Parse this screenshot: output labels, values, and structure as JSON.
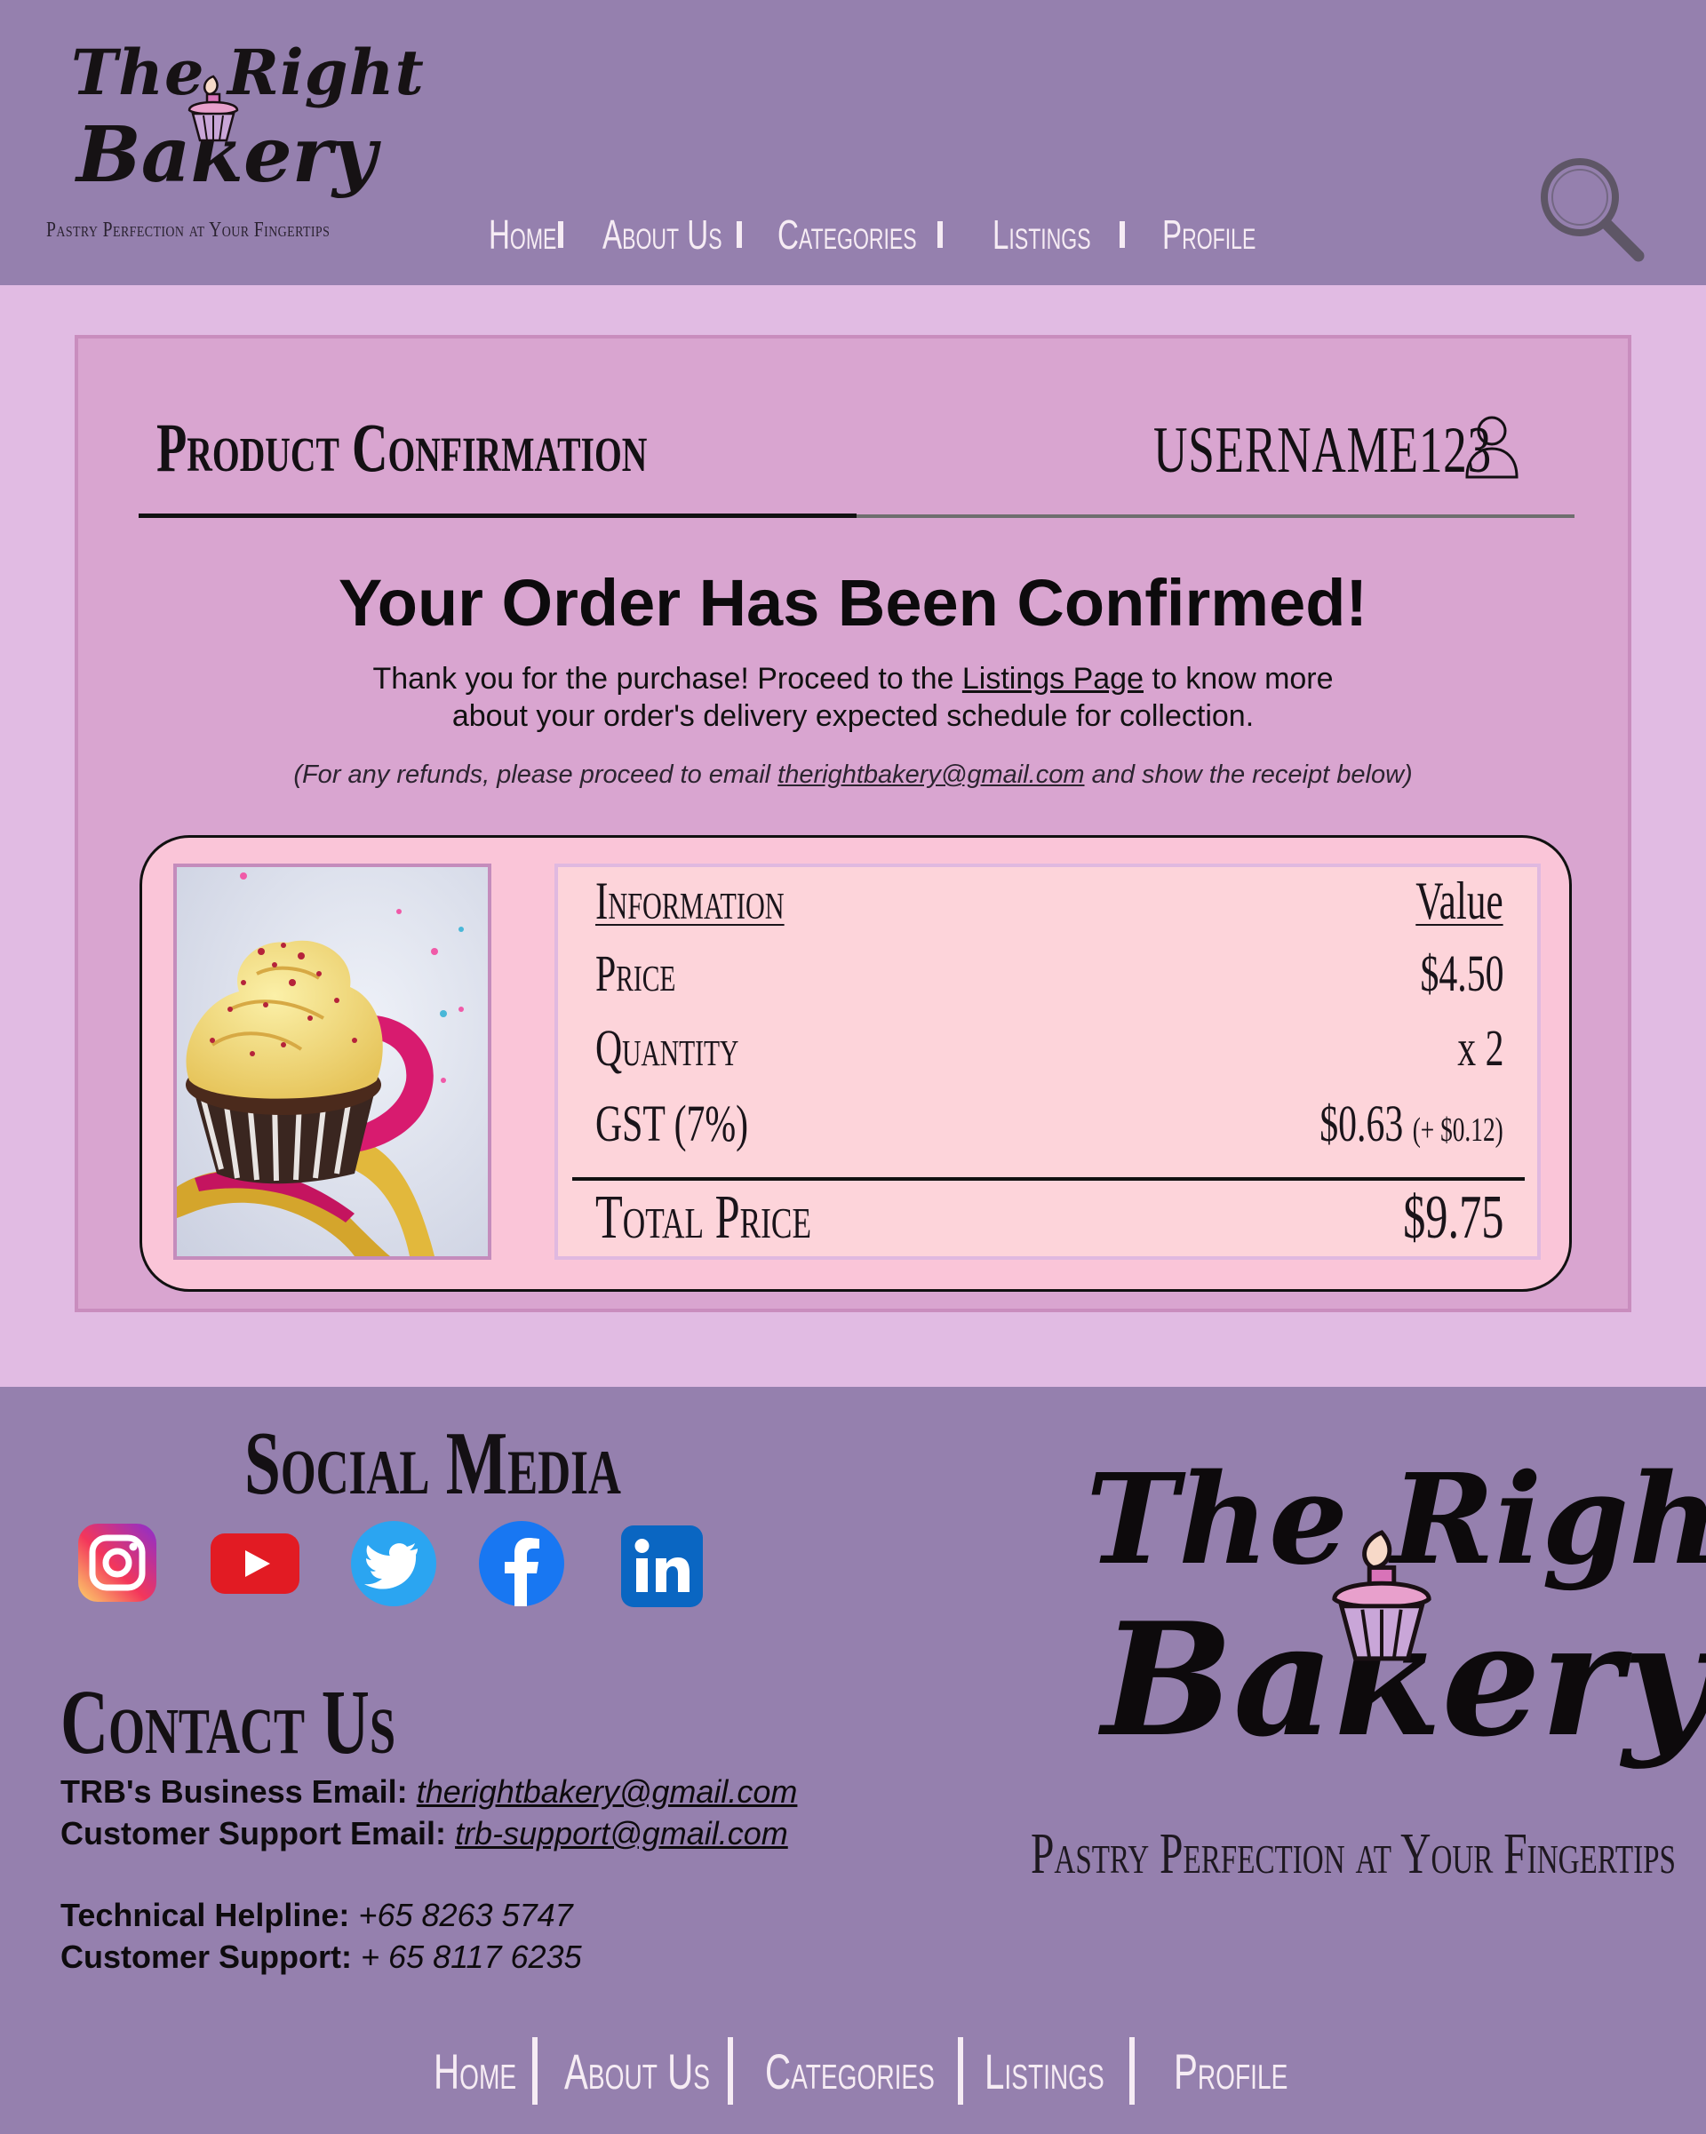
{
  "brand": {
    "line1": "The Right",
    "line2": "Bakery",
    "tagline": "Pastry Perfection at Your Fingertips"
  },
  "nav": {
    "items": [
      {
        "label": "Home"
      },
      {
        "label": "About Us"
      },
      {
        "label": "Categories"
      },
      {
        "label": "Listings"
      },
      {
        "label": "Profile"
      }
    ]
  },
  "icons": {
    "search": "search-icon",
    "user": "user-icon",
    "cupcake": "cupcake-icon"
  },
  "card": {
    "title": "Product Confirmation",
    "username": "USERNAME123",
    "heading": "Your Order Has Been Confirmed!",
    "body_before_link": "Thank you for the purchase! Proceed to the ",
    "listings_link": "Listings Page",
    "body_after_link": " to know more",
    "body_line2": "about your order's delivery expected schedule for collection.",
    "refund_before": "(For any refunds, please proceed to email ",
    "refund_email": "therightbakery@gmail.com",
    "refund_after": " and show the receipt below)"
  },
  "receipt": {
    "header_label": "Information",
    "header_value": "Value",
    "rows": [
      {
        "label": "Price",
        "value": "$4.50",
        "extra": ""
      },
      {
        "label": "Quantity",
        "value": "x 2",
        "extra": ""
      },
      {
        "label": "GST (7%)",
        "value": "$0.63",
        "extra": "(+ $0.12)"
      }
    ],
    "total_label": "Total Price",
    "total_value": "$9.75",
    "image": "cupcake-photo"
  },
  "footer": {
    "social_title": "Social Media",
    "social": [
      {
        "name": "instagram-icon"
      },
      {
        "name": "youtube-icon"
      },
      {
        "name": "twitter-icon"
      },
      {
        "name": "facebook-icon"
      },
      {
        "name": "linkedin-icon"
      }
    ],
    "contact_title": "Contact Us",
    "business_email_label": "TRB's Business Email:",
    "business_email": "therightbakery@gmail.com",
    "support_email_label": "Customer Support Email:",
    "support_email": "trb-support@gmail.com",
    "helpline_label": "Technical Helpline:",
    "helpline": "+65 8263 5747",
    "support_phone_label": "Customer Support:",
    "support_phone": "+ 65 8117 6235"
  },
  "colors": {
    "header_bg": "#9580ae",
    "page_bg": "#e1bbe3",
    "card_bg": "#d9a5d0",
    "receipt_bg": "#fac5d8",
    "info_bg": "#fdd4da"
  }
}
